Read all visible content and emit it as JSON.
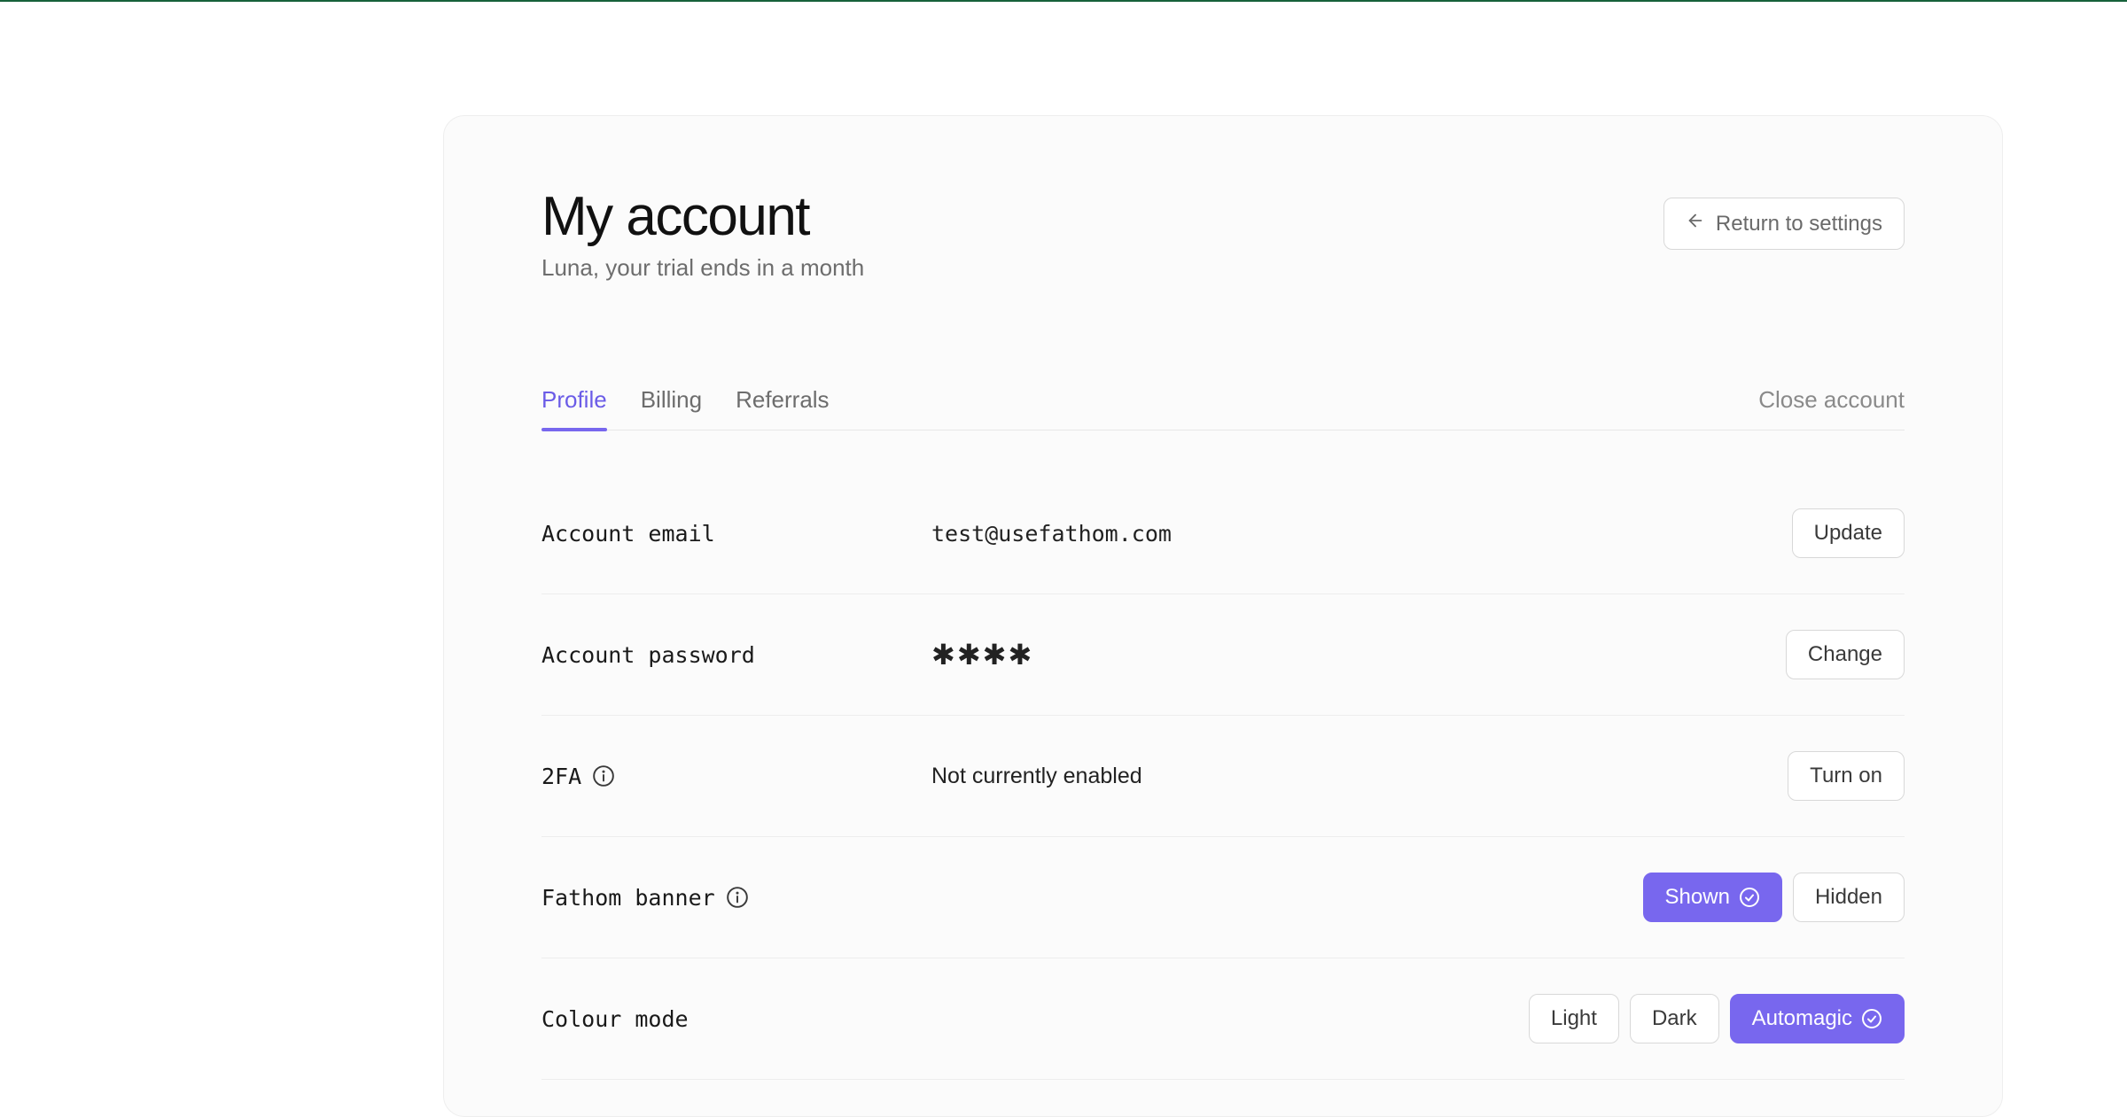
{
  "header": {
    "title": "My account",
    "subtitle": "Luna, your trial ends in a month",
    "return_label": "Return to settings"
  },
  "tabs": {
    "items": [
      "Profile",
      "Billing",
      "Referrals"
    ],
    "active_index": 0,
    "close_label": "Close account"
  },
  "rows": {
    "email": {
      "label": "Account email",
      "value": "test@usefathom.com",
      "action": "Update"
    },
    "password": {
      "label": "Account password",
      "value": "✱✱✱✱",
      "action": "Change"
    },
    "twofa": {
      "label": "2FA",
      "value": "Not currently enabled",
      "action": "Turn on"
    },
    "banner": {
      "label": "Fathom banner",
      "options": [
        "Shown",
        "Hidden"
      ],
      "selected_index": 0
    },
    "colour": {
      "label": "Colour mode",
      "options": [
        "Light",
        "Dark",
        "Automagic"
      ],
      "selected_index": 2
    }
  }
}
